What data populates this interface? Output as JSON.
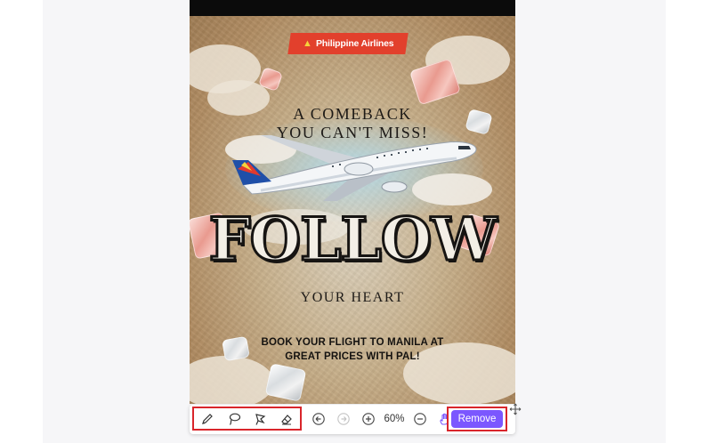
{
  "poster": {
    "logo_text": "Philippine Airlines",
    "headline_line1": "A COMEBACK",
    "headline_line2": "YOU CAN'T MISS!",
    "title": "FOLLOW",
    "subtitle": "YOUR HEART",
    "cta_line1": "BOOK YOUR FLIGHT TO MANILA AT",
    "cta_line2": "GREAT PRICES WITH PAL!"
  },
  "toolbar": {
    "tools": [
      "pen-icon",
      "lasso-icon",
      "polygon-lasso-icon",
      "eraser-icon"
    ],
    "undo_icon": "undo-icon",
    "redo_icon": "redo-icon",
    "zoom_in_icon": "zoom-in-icon",
    "zoom_level": "60%",
    "zoom_out_icon": "zoom-out-icon",
    "hand_icon": "hand-icon",
    "remove_label": "Remove",
    "move_icon": "move-icon"
  },
  "colors": {
    "accent": "#7b57ff",
    "highlight_border": "#d9252b",
    "logo_red": "#e2402c"
  }
}
